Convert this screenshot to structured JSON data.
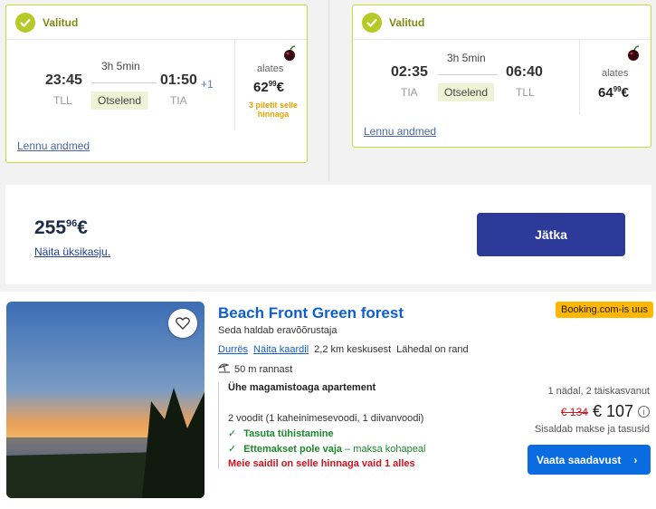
{
  "outbound": {
    "selected_label": "Valitud",
    "depart_time": "23:45",
    "depart_code": "TLL",
    "duration": "3h 5min",
    "direct_label": "Otselend",
    "arrive_time": "01:50",
    "day_offset": "+1",
    "arrive_code": "TIA",
    "from_label": "alates",
    "price_main": "62",
    "price_cents": "99",
    "price_currency": "€",
    "tickets_left": "3 piletit selle hinnaga",
    "details_link": "Lennu andmed"
  },
  "inbound": {
    "selected_label": "Valitud",
    "depart_time": "02:35",
    "depart_code": "TIA",
    "duration": "3h 5min",
    "direct_label": "Otselend",
    "arrive_time": "06:40",
    "arrive_code": "TLL",
    "from_label": "alates",
    "price_main": "64",
    "price_cents": "99",
    "price_currency": "€",
    "details_link": "Lennu andmed"
  },
  "total": {
    "price_main": "255",
    "price_cents": "96",
    "price_currency": "€",
    "show_single_link": "Näita üksikasju.",
    "continue_button": "Jätka"
  },
  "hotel": {
    "name": "Beach Front Green forest",
    "managed_by": "Seda haldab eravõõrustaja",
    "city_link": "Durrës",
    "map_link": "Näita kaardil",
    "distance": "2,2 km keskusest",
    "near_beach": "Lähedal on rand",
    "beach_distance": "50 m rannast",
    "badge": "Booking.com-is uus",
    "room_type": "Ühe magamistoaga apartement",
    "beds": "2 voodit (1 kaheinimesevoodi, 1 diivanvoodi)",
    "free_cancel": "Tasuta tühistamine",
    "no_prepay": "Ettemakset pole vaja",
    "pay_on_site": " – maksa kohapeal",
    "only_left": "Meie saidil on selle hinnaga vaid 1 alles",
    "stay_info": "1 nädal, 2 täiskasvanut",
    "old_price": "€ 134",
    "new_price": "€ 107",
    "taxes": "Sisaldab makse ja tasusid",
    "availability_button": "Vaata saadavust"
  },
  "colors": {
    "selected_accent": "#b7c926",
    "card_border": "#c8dc3c",
    "primary_button": "#2d3a9a",
    "booking_blue": "#0a6ce0",
    "badge_yellow": "#ffb700"
  }
}
